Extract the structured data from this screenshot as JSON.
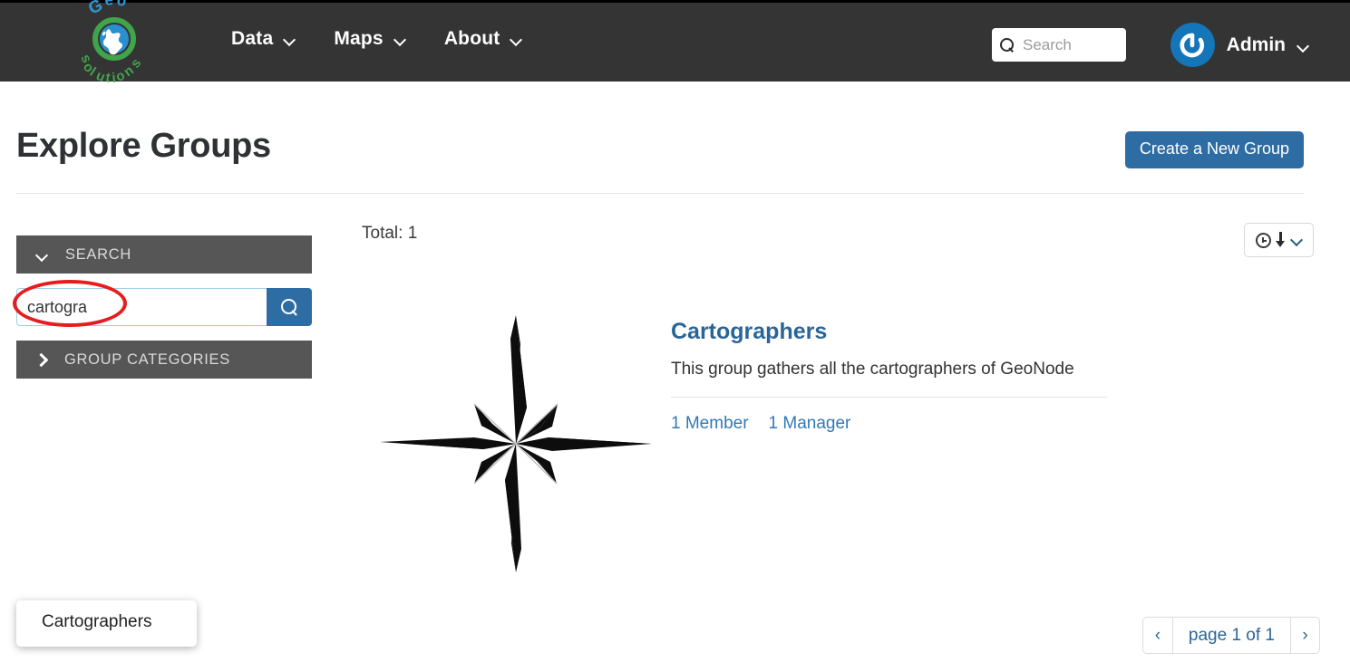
{
  "header": {
    "brand": {
      "name": "geosolutions-logo",
      "top_text": "Geo",
      "bottom_text": "solutions"
    },
    "nav": [
      {
        "label": "Data",
        "icon": "chevron-down-icon"
      },
      {
        "label": "Maps",
        "icon": "chevron-down-icon"
      },
      {
        "label": "About",
        "icon": "chevron-down-icon"
      }
    ],
    "search": {
      "icon": "search-icon",
      "value": "",
      "placeholder": "Search"
    },
    "user": {
      "name": "Admin",
      "avatar_icon": "power-avatar-icon",
      "caret_icon": "chevron-down-icon"
    }
  },
  "page": {
    "title": "Explore Groups",
    "create_button": "Create a New Group"
  },
  "sidebar": {
    "search_panel": {
      "title": "SEARCH",
      "toggle_icon": "chevron-down-icon",
      "input_value": "cartogra",
      "input_placeholder": "",
      "submit_icon": "search-icon"
    },
    "categories_panel": {
      "title": "GROUP CATEGORIES",
      "toggle_icon": "chevron-right-icon"
    },
    "autocomplete": {
      "items": [
        "Cartographers"
      ]
    },
    "annotation": {
      "shape": "ellipse",
      "color": "#e81c1c"
    }
  },
  "results": {
    "total_label": "Total: 1",
    "sort_control": {
      "clock_icon": "clock-icon",
      "direction_icon": "arrow-down-icon",
      "caret_icon": "chevron-down-icon"
    },
    "items": [
      {
        "thumbnail_icon": "compass-rose-icon",
        "title": "Cartographers",
        "description": "This group gathers all the cartographers of GeoNode",
        "members_label": "1 Member",
        "managers_label": "1 Manager"
      }
    ]
  },
  "pagination": {
    "prev_icon": "‹",
    "label": "page 1 of 1",
    "next_icon": "›"
  },
  "colors": {
    "header_bg": "#343434",
    "accent_blue": "#2e6da4",
    "link_blue": "#2b6598",
    "panel_gray": "#565656",
    "annotation_red": "#e81c1c"
  }
}
